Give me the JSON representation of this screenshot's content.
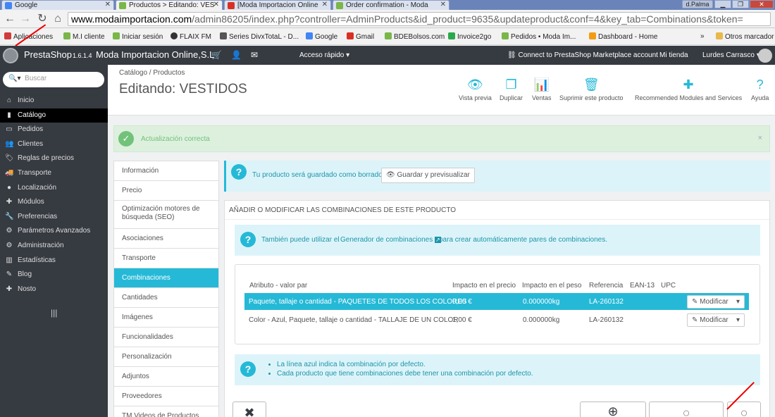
{
  "browser": {
    "tabs": [
      {
        "title": "Google",
        "fav": "#4285f4"
      },
      {
        "title": "Productos > Editando: VES",
        "fav": "#7ab648"
      },
      {
        "title": "[Moda Importacion Online",
        "fav": "#d93025"
      },
      {
        "title": "Order confirmation - Moda",
        "fav": "#7ab648"
      }
    ],
    "user_badge": "d.Palma",
    "url_host": "www.modaimportacion.com",
    "url_path": "/admin86205/index.php?controller=AdminProducts&id_product=9635&updateproduct&conf=4&key_tab=Combinations&token=",
    "bookmarks": [
      {
        "label": "Aplicaciones",
        "color": "#555"
      },
      {
        "label": "M.I cliente",
        "color": "#7ab648"
      },
      {
        "label": "Iniciar sesión",
        "color": "#7ab648"
      },
      {
        "label": "FLAIX FM",
        "color": "#333"
      },
      {
        "label": "Series DivxTotaL - D...",
        "color": "#333"
      },
      {
        "label": "Google",
        "color": "#4285f4"
      },
      {
        "label": "Gmail",
        "color": "#d93025"
      },
      {
        "label": "BDEBolsos.com",
        "color": "#7ab648"
      },
      {
        "label": "Invoice2go",
        "color": "#2aa84a"
      },
      {
        "label": "Pedidos • Moda Im...",
        "color": "#7ab648"
      },
      {
        "label": "Dashboard - Home",
        "color": "#f39c12"
      }
    ],
    "other_bookmarks": "Otros marcador"
  },
  "header": {
    "brand": "PrestaShop",
    "version": "1.6.1.4",
    "shop_name": "Moda Importacion Online,S.L",
    "quick_access": "Acceso rápido",
    "connect": "Connect to PrestaShop Marketplace account",
    "my_shop": "Mi tienda",
    "user": "Lurdes Carrasco"
  },
  "sidebar": {
    "search_placeholder": "Buscar",
    "items": [
      {
        "label": "Inicio",
        "icon": "home-icon"
      },
      {
        "label": "Catálogo",
        "icon": "book-icon"
      },
      {
        "label": "Pedidos",
        "icon": "credit-card-icon"
      },
      {
        "label": "Clientes",
        "icon": "users-icon"
      },
      {
        "label": "Reglas de precios",
        "icon": "tag-icon"
      },
      {
        "label": "Transporte",
        "icon": "truck-icon"
      },
      {
        "label": "Localización",
        "icon": "globe-icon"
      },
      {
        "label": "Módulos",
        "icon": "puzzle-icon"
      },
      {
        "label": "Preferencias",
        "icon": "wrench-icon"
      },
      {
        "label": "Parámetros Avanzados",
        "icon": "cogs-icon"
      },
      {
        "label": "Administración",
        "icon": "cog-icon"
      },
      {
        "label": "Estadísticas",
        "icon": "bar-chart-icon"
      },
      {
        "label": "Blog",
        "icon": "pencil-icon"
      },
      {
        "label": "Nosto",
        "icon": "puzzle-icon"
      }
    ],
    "active": "Catálogo"
  },
  "toolbar": {
    "breadcrumb": "Catálogo  /  Productos",
    "title": "Editando: VESTIDOS",
    "buttons": [
      {
        "label": "Vista previa",
        "icon": "eye-icon",
        "glyph": "👁"
      },
      {
        "label": "Duplicar",
        "icon": "copy-icon",
        "glyph": "❐"
      },
      {
        "label": "Ventas",
        "icon": "bar-chart-icon",
        "glyph": "📊"
      },
      {
        "label": "Suprimir este producto",
        "icon": "trash-icon",
        "glyph": "🗑"
      },
      {
        "label": "Recommended Modules and Services",
        "icon": "puzzle-icon",
        "glyph": "✚"
      },
      {
        "label": "Ayuda",
        "icon": "help-icon",
        "glyph": "?"
      }
    ]
  },
  "alerts": {
    "success": "Actualización correcta",
    "draft": "Tu producto será guardado como borrador.",
    "draft_button": "Guardar y previsualizar",
    "generator_prefix": "También puede utilizar el",
    "generator_link": "Generador de combinaciones",
    "generator_suffix": "para crear automáticamente pares de combinaciones.",
    "footer_notes": [
      "La línea azul indica la combinación por defecto.",
      "Cada producto que tiene combinaciones debe tener una combinación por defecto."
    ]
  },
  "product_tabs": [
    "Información",
    "Precio",
    "Optimización motores de búsqueda (SEO)",
    "Asociaciones",
    "Transporte",
    "Combinaciones",
    "Cantidades",
    "Imágenes",
    "Funcionalidades",
    "Personalización",
    "Adjuntos",
    "Proveedores",
    "TM Videos de Productos"
  ],
  "active_tab": "Combinaciones",
  "combinations": {
    "panel_title": "Añadir o modificar las combinaciones de este producto",
    "headers": [
      "Atributo - valor par",
      "Impacto en el precio",
      "Impacto en el peso",
      "Referencia",
      "EAN-13",
      "UPC"
    ],
    "rows": [
      {
        "attribute": "Paquete, tallaje o cantidad - PAQUETES DE TODOS LOS COLORES",
        "price": "0,00 €",
        "weight": "0.000000kg",
        "ref": "LA-260132",
        "default": true
      },
      {
        "attribute": "Color - Azul, Paquete, tallaje o cantidad - TALLAJE DE UN COLOR",
        "price": "1,00 €",
        "weight": "0.000000kg",
        "ref": "LA-260132",
        "default": false
      }
    ],
    "modify_label": "Modificar"
  }
}
